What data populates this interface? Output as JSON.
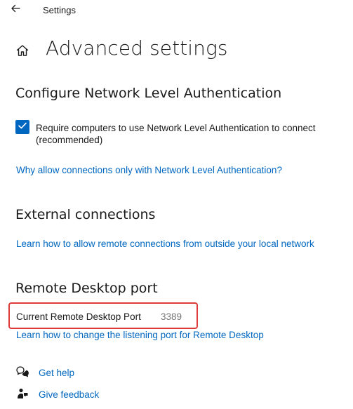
{
  "titlebar": {
    "back_icon": "arrow-left-icon",
    "title": "Settings"
  },
  "header": {
    "home_icon": "home-icon",
    "title": "Advanced settings"
  },
  "nla": {
    "heading": "Configure Network Level Authentication",
    "checkbox_checked": true,
    "checkbox_label": "Require computers to use Network Level Authentication to connect (recommended)",
    "link": "Why allow connections only with Network Level Authentication?"
  },
  "external": {
    "heading": "External connections",
    "link": "Learn how to allow remote connections from outside your local network"
  },
  "port": {
    "heading": "Remote Desktop port",
    "label": "Current Remote Desktop Port",
    "value": "3389",
    "link": "Learn how to change the listening port for Remote Desktop",
    "highlight_color": "#dd3a3a"
  },
  "footer": {
    "help_icon": "chat-help-icon",
    "help_label": "Get help",
    "feedback_icon": "feedback-person-icon",
    "feedback_label": "Give feedback"
  },
  "colors": {
    "accent": "#0067c0",
    "text": "#1a1a1a",
    "muted": "#767676"
  }
}
